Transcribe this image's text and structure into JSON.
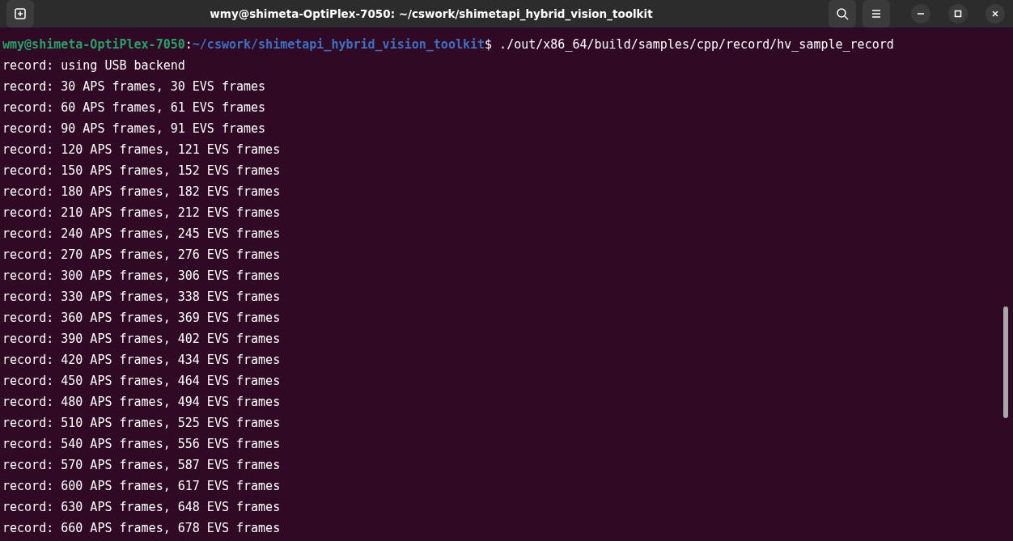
{
  "window": {
    "title": "wmy@shimeta-OptiPlex-7050: ~/cswork/shimetapi_hybrid_vision_toolkit"
  },
  "terminal": {
    "prompt": {
      "user_host": "wmy@shimeta-OptiPlex-7050",
      "separator": ":",
      "path": "~/cswork/shimetapi_hybrid_vision_toolkit",
      "symbol": "$",
      "command": "./out/x86_64/build/samples/cpp/record/hv_sample_record"
    },
    "lines": [
      "record: using USB backend",
      "record: 30 APS frames, 30 EVS frames",
      "record: 60 APS frames, 61 EVS frames",
      "record: 90 APS frames, 91 EVS frames",
      "record: 120 APS frames, 121 EVS frames",
      "record: 150 APS frames, 152 EVS frames",
      "record: 180 APS frames, 182 EVS frames",
      "record: 210 APS frames, 212 EVS frames",
      "record: 240 APS frames, 245 EVS frames",
      "record: 270 APS frames, 276 EVS frames",
      "record: 300 APS frames, 306 EVS frames",
      "record: 330 APS frames, 338 EVS frames",
      "record: 360 APS frames, 369 EVS frames",
      "record: 390 APS frames, 402 EVS frames",
      "record: 420 APS frames, 434 EVS frames",
      "record: 450 APS frames, 464 EVS frames",
      "record: 480 APS frames, 494 EVS frames",
      "record: 510 APS frames, 525 EVS frames",
      "record: 540 APS frames, 556 EVS frames",
      "record: 570 APS frames, 587 EVS frames",
      "record: 600 APS frames, 617 EVS frames",
      "record: 630 APS frames, 648 EVS frames",
      "record: 660 APS frames, 678 EVS frames"
    ]
  }
}
